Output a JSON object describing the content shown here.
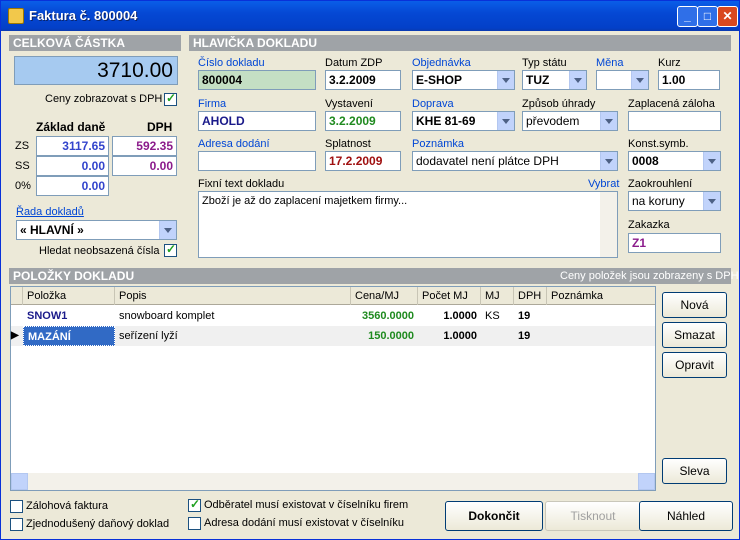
{
  "window": {
    "title": "Faktura č. 800004",
    "min": "_",
    "max": "□",
    "close": "✕"
  },
  "celkova": {
    "header": "CELKOVÁ ČÁSTKA",
    "amount": "3710.00",
    "ceny_dph_label": "Ceny zobrazovat s DPH",
    "zaklad_header": "Základ daně",
    "dph_header": "DPH",
    "rows": [
      {
        "label": "ZS",
        "zaklad": "3117.65",
        "dph": "592.35"
      },
      {
        "label": "SS",
        "zaklad": "0.00",
        "dph": "0.00"
      },
      {
        "label": "0%",
        "zaklad": "0.00"
      }
    ],
    "rada_label": "Řada dokladů",
    "rada_value": "« HLAVNÍ »",
    "hledat_label": "Hledat neobsazená čísla"
  },
  "hlavicka": {
    "header": "HLAVIČKA DOKLADU",
    "cislo_label": "Číslo dokladu",
    "cislo_value": "800004",
    "datum_label": "Datum ZDP",
    "datum_value": "3.2.2009",
    "objednavka_label": "Objednávka",
    "objednavka_value": "E-SHOP",
    "typ_label": "Typ státu",
    "typ_value": "TUZ",
    "mena_label": "Měna",
    "mena_value": "",
    "kurz_label": "Kurz",
    "kurz_value": "1.00",
    "firma_label": "Firma",
    "firma_value": "AHOLD",
    "vystaveni_label": "Vystavení",
    "vystaveni_value": "3.2.2009",
    "doprava_label": "Doprava",
    "doprava_value": "KHE 81-69",
    "zpusob_label": "Způsob úhrady",
    "zpusob_value": "převodem",
    "zaloha_label": "Zaplacená záloha",
    "zaloha_value": "",
    "adresa_label": "Adresa dodání",
    "adresa_value": "",
    "splatnost_label": "Splatnost",
    "splatnost_value": "17.2.2009",
    "poznamka_label": "Poznámka",
    "poznamka_value": "dodavatel není plátce DPH",
    "konst_label": "Konst.symb.",
    "konst_value": "0008",
    "fixni_label": "Fixní text dokladu",
    "vybrat_label": "Vybrat",
    "fixni_value": "Zboží je až do zaplacení majetkem firmy...",
    "zaokrouhleni_label": "Zaokrouhlení",
    "zaokrouhleni_value": "na koruny",
    "zakazka_label": "Zakazka",
    "zakazka_value": "Z1"
  },
  "polozky": {
    "header": "POLOŽKY DOKLADU",
    "note": "Ceny položek jsou zobrazeny s DPH",
    "columns": [
      "Položka",
      "Popis",
      "Cena/MJ",
      "Počet MJ",
      "MJ",
      "DPH %",
      "Poznámka"
    ],
    "rows": [
      {
        "polozka": "SNOW1",
        "popis": "snowboard komplet",
        "cena": "3560.0000",
        "pocet": "1.0000",
        "mj": "KS",
        "dph": "19"
      },
      {
        "polozka": "MAZÁNÍ",
        "popis": "seřízení lyží",
        "cena": "150.0000",
        "pocet": "1.0000",
        "mj": "",
        "dph": "19"
      }
    ],
    "buttons": {
      "nova": "Nová",
      "smazat": "Smazat",
      "opravit": "Opravit",
      "sleva": "Sleva"
    }
  },
  "footer": {
    "zalohova": "Zálohová faktura",
    "zjednoduseny": "Zjednodušený daňový doklad",
    "odberatel": "Odběratel musí existovat v číselníku firem",
    "adresa_exist": "Adresa dodání musí existovat v číselníku",
    "dokoncit": "Dokončit",
    "tisknout": "Tisknout",
    "nahled": "Náhled"
  }
}
